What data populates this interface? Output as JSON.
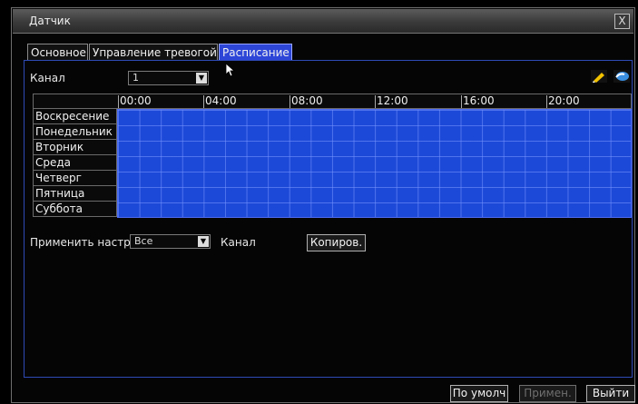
{
  "window": {
    "title": "Датчик",
    "close_symbol": "X"
  },
  "tabs": [
    {
      "label": "Основное",
      "active": false
    },
    {
      "label": "Управление тревогой",
      "active": false
    },
    {
      "label": "Расписание",
      "active": true
    }
  ],
  "channel": {
    "label": "Канал",
    "value": "1"
  },
  "schedule": {
    "hours": [
      "00:00",
      "04:00",
      "08:00",
      "12:00",
      "16:00",
      "20:00"
    ],
    "days": [
      "Воскресение",
      "Понедельник",
      "Вторник",
      "Среда",
      "Четверг",
      "Пятница",
      "Суббота"
    ],
    "fill_color": "#1d49d8",
    "all_slots_enabled": true
  },
  "apply": {
    "label": "Применить настр",
    "value": "Все",
    "channel_label": "Канал",
    "copy_button": "Копиров."
  },
  "footer": {
    "default_button": "По умолч",
    "apply_button": "Примен.",
    "exit_button": "Выйти"
  },
  "icons": {
    "edit": "pencil-icon",
    "erase": "eraser-icon"
  }
}
